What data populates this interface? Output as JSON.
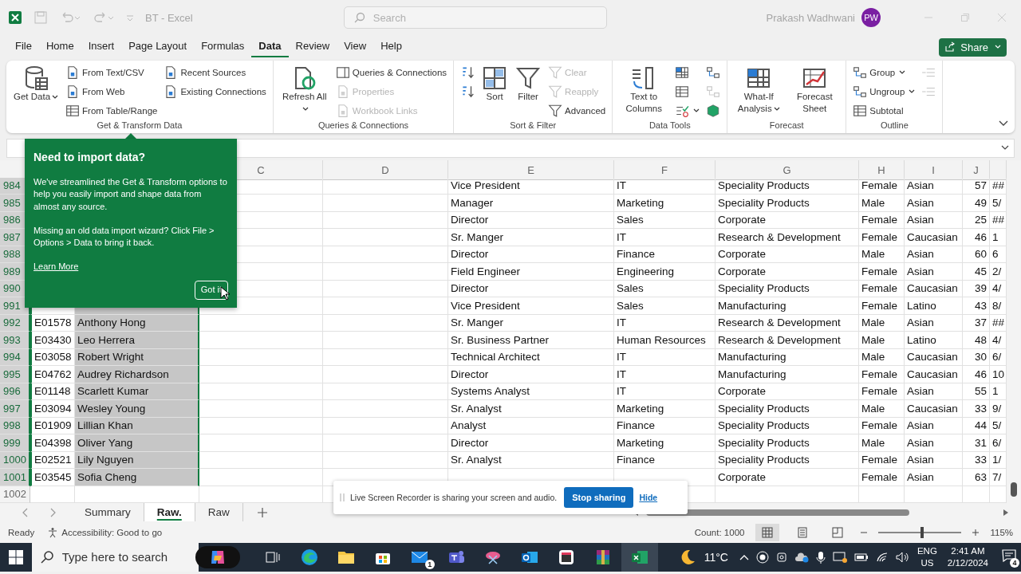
{
  "title_bar": {
    "file_name": "BT  -  Excel",
    "search_placeholder": "Search",
    "user_name": "Prakash Wadhwani",
    "user_initials": "PW"
  },
  "menu_tabs": [
    {
      "label": "File",
      "selected": false
    },
    {
      "label": "Home",
      "selected": false
    },
    {
      "label": "Insert",
      "selected": false
    },
    {
      "label": "Page Layout",
      "selected": false
    },
    {
      "label": "Formulas",
      "selected": false
    },
    {
      "label": "Data",
      "selected": true
    },
    {
      "label": "Review",
      "selected": false
    },
    {
      "label": "View",
      "selected": false
    },
    {
      "label": "Help",
      "selected": false
    }
  ],
  "share_button": {
    "label": "Share"
  },
  "ribbon_groups": [
    {
      "label": "Get & Transform Data",
      "items": [
        {
          "label": "Get Data",
          "kind": "large",
          "dropdown": true,
          "disabled": false
        },
        {
          "label": "From Text/CSV",
          "kind": "small",
          "dropdown": false,
          "disabled": false
        },
        {
          "label": "From Web",
          "kind": "small",
          "dropdown": false,
          "disabled": false
        },
        {
          "label": "From Table/Range",
          "kind": "small",
          "dropdown": false,
          "disabled": false
        },
        {
          "label": "Recent Sources",
          "kind": "small",
          "dropdown": false,
          "disabled": false
        },
        {
          "label": "Existing Connections",
          "kind": "small",
          "dropdown": false,
          "disabled": false
        }
      ]
    },
    {
      "label": "Queries & Connections",
      "items": [
        {
          "label": "Refresh All",
          "kind": "large",
          "dropdown": true,
          "disabled": false
        },
        {
          "label": "Queries & Connections",
          "kind": "small",
          "dropdown": false,
          "disabled": false
        },
        {
          "label": "Properties",
          "kind": "small",
          "dropdown": false,
          "disabled": true
        },
        {
          "label": "Workbook Links",
          "kind": "small",
          "dropdown": false,
          "disabled": true
        }
      ]
    },
    {
      "label": "Sort & Filter",
      "items": [
        {
          "kind": "icon",
          "dropdown": false,
          "disabled": false
        },
        {
          "kind": "icon",
          "dropdown": false,
          "disabled": false
        },
        {
          "label": "Sort",
          "kind": "large",
          "dropdown": false,
          "disabled": false
        },
        {
          "label": "Filter",
          "kind": "large",
          "dropdown": false,
          "disabled": false
        },
        {
          "label": "Clear",
          "kind": "small",
          "dropdown": false,
          "disabled": true
        },
        {
          "label": "Reapply",
          "kind": "small",
          "dropdown": false,
          "disabled": true
        },
        {
          "label": "Advanced",
          "kind": "small",
          "dropdown": false,
          "disabled": false
        }
      ]
    },
    {
      "label": "Data Tools",
      "items": [
        {
          "label": "Text to Columns",
          "kind": "large",
          "dropdown": false,
          "disabled": false
        },
        {
          "kind": "icon",
          "dropdown": false,
          "disabled": false
        },
        {
          "kind": "icon",
          "dropdown": false,
          "disabled": false
        },
        {
          "kind": "icon",
          "dropdown": true,
          "disabled": false
        },
        {
          "kind": "icon",
          "dropdown": false,
          "disabled": false
        },
        {
          "kind": "icon",
          "dropdown": false,
          "disabled": true
        },
        {
          "kind": "icon",
          "dropdown": false,
          "disabled": false
        }
      ]
    },
    {
      "label": "Forecast",
      "items": [
        {
          "label": "What-If Analysis",
          "kind": "large",
          "dropdown": true,
          "disabled": false
        },
        {
          "label": "Forecast Sheet",
          "kind": "large",
          "dropdown": false,
          "disabled": false
        }
      ]
    },
    {
      "label": "Outline",
      "items": [
        {
          "label": "Group",
          "kind": "small",
          "dropdown": true,
          "disabled": false
        },
        {
          "label": "Ungroup",
          "kind": "small",
          "dropdown": true,
          "disabled": false
        },
        {
          "label": "Subtotal",
          "kind": "small",
          "dropdown": false,
          "disabled": false
        },
        {
          "kind": "icon",
          "dropdown": false,
          "disabled": true
        },
        {
          "kind": "icon",
          "dropdown": false,
          "disabled": true
        }
      ]
    }
  ],
  "popup": {
    "title": "Need to import data?",
    "paragraphs": [
      "We've streamlined the Get & Transform options to help you easily import and shape data from almost any source.",
      "Missing an old data import wizard? Click File > Options >  Data to bring it back."
    ],
    "link": "Learn More",
    "button": "Got it"
  },
  "column_headers": [
    "C",
    "D",
    "E",
    "F",
    "G",
    "H",
    "I",
    "J"
  ],
  "rows": [
    {
      "number": "984",
      "selected": true,
      "col_e": "Vice President",
      "col_f": "IT",
      "col_g": "Speciality Products",
      "col_h": "Female",
      "col_i": "Asian",
      "col_j": "57",
      "col_k": "##"
    },
    {
      "number": "985",
      "selected": true,
      "col_e": "Manager",
      "col_f": "Marketing",
      "col_g": "Speciality Products",
      "col_h": "Male",
      "col_i": "Asian",
      "col_j": "49",
      "col_k": "5/"
    },
    {
      "number": "986",
      "selected": true,
      "col_e": "Director",
      "col_f": "Sales",
      "col_g": "Corporate",
      "col_h": "Female",
      "col_i": "Asian",
      "col_j": "25",
      "col_k": "##"
    },
    {
      "number": "987",
      "selected": true,
      "col_e": "Sr. Manger",
      "col_f": "IT",
      "col_g": "Research & Development",
      "col_h": "Female",
      "col_i": "Caucasian",
      "col_j": "46",
      "col_k": "1"
    },
    {
      "number": "988",
      "selected": true,
      "col_e": "Director",
      "col_f": "Finance",
      "col_g": "Corporate",
      "col_h": "Male",
      "col_i": "Asian",
      "col_j": "60",
      "col_k": "6"
    },
    {
      "number": "989",
      "selected": true,
      "col_e": "Field Engineer",
      "col_f": "Engineering",
      "col_g": "Corporate",
      "col_h": "Female",
      "col_i": "Asian",
      "col_j": "45",
      "col_k": "2/"
    },
    {
      "number": "990",
      "selected": true,
      "col_e": "Director",
      "col_f": "Sales",
      "col_g": "Speciality Products",
      "col_h": "Female",
      "col_i": "Caucasian",
      "col_j": "39",
      "col_k": "4/"
    },
    {
      "number": "991",
      "selected": true,
      "col_e": "Vice President",
      "col_f": "Sales",
      "col_g": "Manufacturing",
      "col_h": "Female",
      "col_i": "Latino",
      "col_j": "43",
      "col_k": "8/"
    },
    {
      "number": "992",
      "selected": true,
      "col_a": "E01578",
      "col_b": "Anthony Hong",
      "col_e": "Sr. Manger",
      "col_f": "IT",
      "col_g": "Research & Development",
      "col_h": "Male",
      "col_i": "Asian",
      "col_j": "37",
      "col_k": "##"
    },
    {
      "number": "993",
      "selected": true,
      "col_a": "E03430",
      "col_b": "Leo Herrera",
      "col_e": "Sr. Business Partner",
      "col_f": "Human Resources",
      "col_g": "Research & Development",
      "col_h": "Male",
      "col_i": "Latino",
      "col_j": "48",
      "col_k": "4/"
    },
    {
      "number": "994",
      "selected": true,
      "col_a": "E03058",
      "col_b": "Robert Wright",
      "col_e": "Technical Architect",
      "col_f": "IT",
      "col_g": "Manufacturing",
      "col_h": "Male",
      "col_i": "Caucasian",
      "col_j": "30",
      "col_k": "6/"
    },
    {
      "number": "995",
      "selected": true,
      "col_a": "E04762",
      "col_b": "Audrey Richardson",
      "col_e": "Director",
      "col_f": "IT",
      "col_g": "Manufacturing",
      "col_h": "Female",
      "col_i": "Caucasian",
      "col_j": "46",
      "col_k": "10"
    },
    {
      "number": "996",
      "selected": true,
      "col_a": "E01148",
      "col_b": "Scarlett Kumar",
      "col_e": "Systems Analyst",
      "col_f": "IT",
      "col_g": "Corporate",
      "col_h": "Female",
      "col_i": "Asian",
      "col_j": "55",
      "col_k": "1"
    },
    {
      "number": "997",
      "selected": true,
      "col_a": "E03094",
      "col_b": "Wesley Young",
      "col_e": "Sr. Analyst",
      "col_f": "Marketing",
      "col_g": "Speciality Products",
      "col_h": "Male",
      "col_i": "Caucasian",
      "col_j": "33",
      "col_k": "9/"
    },
    {
      "number": "998",
      "selected": true,
      "col_a": "E01909",
      "col_b": "Lillian Khan",
      "col_e": "Analyst",
      "col_f": "Finance",
      "col_g": "Speciality Products",
      "col_h": "Female",
      "col_i": "Asian",
      "col_j": "44",
      "col_k": "5/"
    },
    {
      "number": "999",
      "selected": true,
      "col_a": "E04398",
      "col_b": "Oliver Yang",
      "col_e": "Director",
      "col_f": "Marketing",
      "col_g": "Speciality Products",
      "col_h": "Male",
      "col_i": "Asian",
      "col_j": "31",
      "col_k": "6/"
    },
    {
      "number": "1000",
      "selected": true,
      "col_a": "E02521",
      "col_b": "Lily Nguyen",
      "col_e": "Sr. Analyst",
      "col_f": "Finance",
      "col_g": "Speciality Products",
      "col_h": "Female",
      "col_i": "Asian",
      "col_j": "33",
      "col_k": "1/"
    },
    {
      "number": "1001",
      "selected": true,
      "col_a": "E03545",
      "col_b": "Sofia Cheng",
      "col_g": "Corporate",
      "col_h": "Female",
      "col_i": "Asian",
      "col_j": "63",
      "col_k": "7/"
    },
    {
      "number": "1002",
      "selected": false
    }
  ],
  "sheet_tabs": [
    {
      "label": "Summary",
      "selected": false
    },
    {
      "label": "Raw.",
      "selected": true
    },
    {
      "label": "Raw",
      "selected": false
    }
  ],
  "recorder_banner": {
    "message": "Live Screen Recorder is sharing your screen and audio.",
    "stop_button": "Stop sharing",
    "hide_link": "Hide"
  },
  "status_bar": {
    "mode": "Ready",
    "accessibility": "Accessibility: Good to go",
    "count": "Count: 1000",
    "zoom": "115%",
    "zoom_slider": {
      "level": 0.52
    },
    "views": [
      {
        "selected": true
      },
      {
        "selected": false
      },
      {
        "selected": false
      }
    ]
  },
  "taskbar": {
    "search_placeholder": "Type here to search",
    "mail_badge": "1",
    "temperature": "11°C",
    "language": "ENG",
    "region": "US",
    "time": "2:41 AM",
    "date": "2/12/2024",
    "notification_count": "4"
  }
}
